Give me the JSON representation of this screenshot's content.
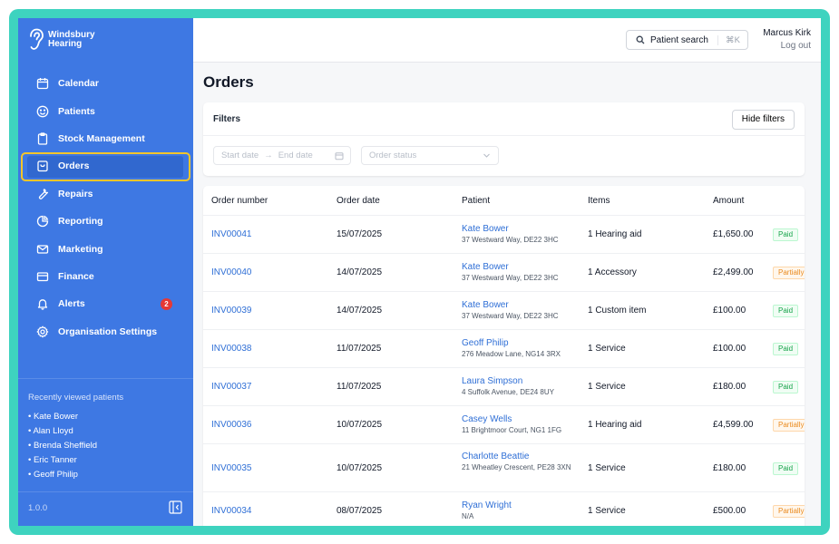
{
  "brand": {
    "line1": "Windsbury",
    "line2": "Hearing"
  },
  "nav": {
    "items": [
      {
        "label": "Calendar",
        "icon": "calendar-icon"
      },
      {
        "label": "Patients",
        "icon": "smile-icon"
      },
      {
        "label": "Stock Management",
        "icon": "clipboard-icon"
      },
      {
        "label": "Orders",
        "icon": "archive-icon",
        "active": true
      },
      {
        "label": "Repairs",
        "icon": "wrench-icon"
      },
      {
        "label": "Reporting",
        "icon": "pie-chart-icon"
      },
      {
        "label": "Marketing",
        "icon": "mail-icon"
      },
      {
        "label": "Finance",
        "icon": "credit-card-icon"
      },
      {
        "label": "Alerts",
        "icon": "bell-icon",
        "badge": "2"
      },
      {
        "label": "Organisation Settings",
        "icon": "gear-icon"
      }
    ]
  },
  "recent": {
    "title": "Recently viewed patients",
    "items": [
      "• Kate Bower",
      "• Alan Lloyd",
      "• Brenda Sheffield",
      "• Eric Tanner",
      "• Geoff Philip"
    ]
  },
  "version": "1.0.0",
  "header": {
    "search_label": "Patient search",
    "search_shortcut": "⌘K",
    "user_name": "Marcus Kirk",
    "logout": "Log out"
  },
  "page": {
    "title": "Orders"
  },
  "filters": {
    "title": "Filters",
    "hide_button": "Hide filters",
    "start_placeholder": "Start date",
    "end_placeholder": "End date",
    "arrow": "→",
    "status_placeholder": "Order status"
  },
  "table": {
    "columns": [
      "Order number",
      "Order date",
      "Patient",
      "Items",
      "Amount"
    ],
    "rows": [
      {
        "order": "INV00041",
        "date": "15/07/2025",
        "patient": "Kate Bower",
        "address": "37 Westward Way, DE22 3HC",
        "items": "1 Hearing aid",
        "amount": "£1,650.00",
        "status": "Paid"
      },
      {
        "order": "INV00040",
        "date": "14/07/2025",
        "patient": "Kate Bower",
        "address": "37 Westward Way, DE22 3HC",
        "items": "1 Accessory",
        "amount": "£2,499.00",
        "status": "Partially"
      },
      {
        "order": "INV00039",
        "date": "14/07/2025",
        "patient": "Kate Bower",
        "address": "37 Westward Way, DE22 3HC",
        "items": "1 Custom item",
        "amount": "£100.00",
        "status": "Paid"
      },
      {
        "order": "INV00038",
        "date": "11/07/2025",
        "patient": "Geoff Philip",
        "address": "276 Meadow Lane, NG14 3RX",
        "items": "1 Service",
        "amount": "£100.00",
        "status": "Paid"
      },
      {
        "order": "INV00037",
        "date": "11/07/2025",
        "patient": "Laura Simpson",
        "address": "4 Suffolk Avenue, DE24 8UY",
        "items": "1 Service",
        "amount": "£180.00",
        "status": "Paid"
      },
      {
        "order": "INV00036",
        "date": "10/07/2025",
        "patient": "Casey Wells",
        "address": "11 Brightmoor Court, NG1 1FG",
        "items": "1 Hearing aid",
        "amount": "£4,599.00",
        "status": "Partially"
      },
      {
        "order": "INV00035",
        "date": "10/07/2025",
        "patient": "Charlotte Beattie",
        "address": "21 Wheatley Crescent, PE28 3XN",
        "items": "1 Service",
        "amount": "£180.00",
        "status": "Paid"
      },
      {
        "order": "INV00034",
        "date": "08/07/2025",
        "patient": "Ryan Wright",
        "address": "N/A",
        "items": "1 Service",
        "amount": "£500.00",
        "status": "Partially"
      }
    ]
  },
  "colors": {
    "sidebar": "#3e78e3",
    "accent": "#2f6fd6",
    "frame": "#3ed3bf",
    "highlight": "#f3c52a"
  }
}
